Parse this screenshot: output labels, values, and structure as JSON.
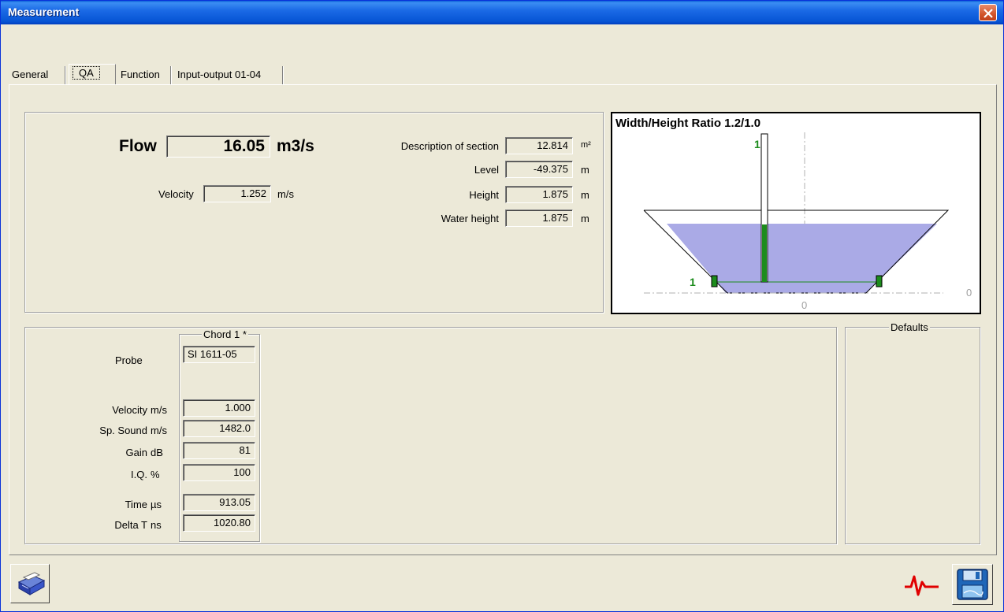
{
  "window": {
    "title": "Measurement"
  },
  "tabs": [
    {
      "label": "General",
      "active": false
    },
    {
      "label": "QA",
      "active": true
    },
    {
      "label": "Function",
      "active": false
    },
    {
      "label": "Input-output 01-04",
      "active": false
    }
  ],
  "flow": {
    "label": "Flow",
    "value": "16.05",
    "unit": "m3/s"
  },
  "velocity": {
    "label": "Velocity",
    "value": "1.252",
    "unit": "m/s"
  },
  "section": {
    "description": {
      "label": "Description of section",
      "value": "12.814",
      "unit": "m²"
    },
    "level": {
      "label": "Level",
      "value": "-49.375",
      "unit": "m"
    },
    "height": {
      "label": "Height",
      "value": "1.875",
      "unit": "m"
    },
    "water_height": {
      "label": "Water height",
      "value": "1.875",
      "unit": "m"
    }
  },
  "diagram": {
    "title": "Width/Height Ratio 1.2/1.0",
    "chord_label_top": "1",
    "chord_label_left": "1",
    "axis_zero_right": "0",
    "axis_zero_bottom": "0",
    "fill_color": "#aaaae6",
    "chord_color": "#1c8c1c",
    "chord_fill_fraction": 0.39
  },
  "chord": {
    "group_title": "Chord 1 *",
    "probe_label": "Probe",
    "probe_value": "SI 1611-05",
    "rows": [
      {
        "label": "Velocity",
        "unit": "m/s",
        "value": "1.000"
      },
      {
        "label": "Sp. Sound",
        "unit": "m/s",
        "value": "1482.0"
      },
      {
        "label": "Gain",
        "unit": "dB",
        "value": "81"
      },
      {
        "label": "I.Q.",
        "unit": "%",
        "value": "100"
      },
      {
        "label": "Time",
        "unit": "µs",
        "value": "913.05"
      },
      {
        "label": "Delta T",
        "unit": "ns",
        "value": "1020.80"
      }
    ]
  },
  "defaults": {
    "group_title": "Defaults"
  },
  "toolbar": {
    "print_icon": "printer-icon",
    "signal_icon": "signal-wave-icon",
    "save_icon": "floppy-disk-icon"
  }
}
